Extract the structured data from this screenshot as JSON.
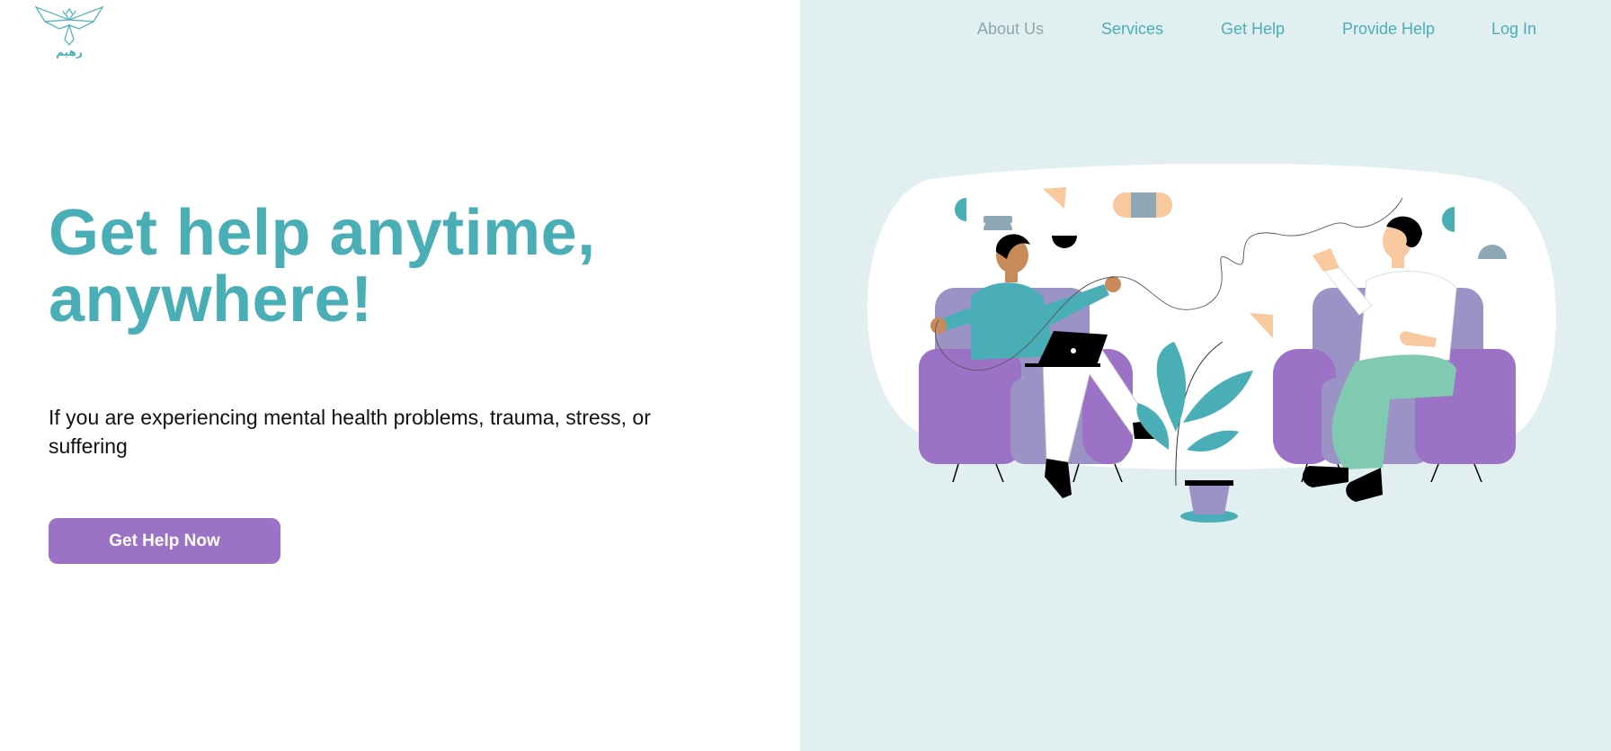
{
  "brand": {
    "logo_text": "رهيم",
    "logo_icon": "phoenix-bird-icon"
  },
  "nav": {
    "items": [
      {
        "label": "About Us"
      },
      {
        "label": "Services"
      },
      {
        "label": "Get Help"
      },
      {
        "label": "Provide Help"
      },
      {
        "label": "Log In"
      }
    ]
  },
  "hero": {
    "headline_line1": "Get help anytime,",
    "headline_line2": "anywhere!",
    "subtext": "If you are experiencing mental health problems, trauma, stress, or suffering",
    "cta_label": "Get Help Now",
    "illustration": "two-people-therapy-session-illustration"
  },
  "colors": {
    "accent_teal": "#4aaeb7",
    "button_purple": "#9b72c6",
    "panel_bg": "#e1eff0",
    "muted_nav": "#8aa9ad"
  }
}
